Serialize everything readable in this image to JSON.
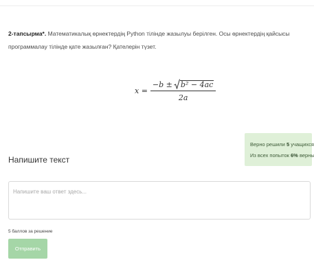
{
  "task": {
    "number_label": "2-тапсырма*.",
    "text": "Математикалық өрнектердің Python тілінде жазылуы берілген. Осы өрнектердің қайсысы программалау тілінде қате жазылған? Қателерін түзет."
  },
  "formula": {
    "lhs": "x =",
    "numerator_prefix": "−b ±",
    "radicand": "b² − 4ac",
    "denominator": "2a"
  },
  "stats": {
    "solved_prefix": "Верно решили",
    "solved_count": "5",
    "solved_suffix": "учащихся",
    "attempts_prefix": "Из всех попыток",
    "attempts_percent": "6%",
    "attempts_suffix": "верных"
  },
  "answer_section": {
    "title": "Напишите текст",
    "placeholder": "Напишите ваш ответ здесь...",
    "points_text": "5 баллов за решение",
    "submit_label": "Отправить"
  }
}
